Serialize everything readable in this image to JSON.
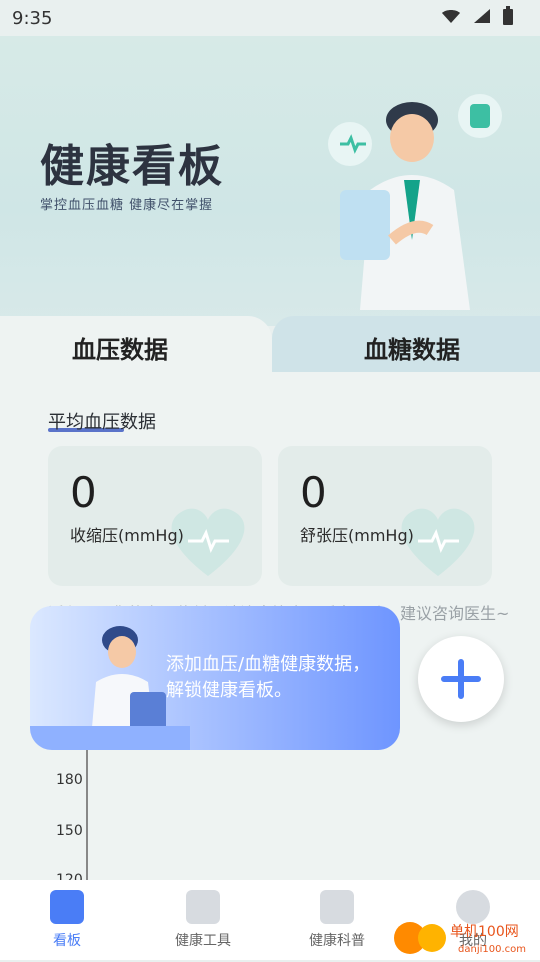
{
  "status": {
    "time": "9:35"
  },
  "hero": {
    "title": "健康看板",
    "subtitle": "掌控血压血糖 健康尽在掌握"
  },
  "tabs": [
    {
      "label": "血压数据"
    },
    {
      "label": "血糖数据"
    }
  ],
  "section": {
    "title": "平均血压数据"
  },
  "stats": [
    {
      "value": "0",
      "label": "收缩压(mmHg)"
    },
    {
      "value": "0",
      "label": "舒张压(mmHg)"
    }
  ],
  "hint": "近七天，您的血压偏低，请注意饮食，适当运动，建议咨询医生~",
  "popup": {
    "text": "添加血压/血糖健康数据，解锁健康看板。"
  },
  "chart": {
    "ticks": [
      "180",
      "150",
      "120"
    ]
  },
  "nav": [
    {
      "label": "看板",
      "icon": "dashboard-icon",
      "active": true
    },
    {
      "label": "健康工具",
      "icon": "toolbox-icon",
      "active": false
    },
    {
      "label": "健康科普",
      "icon": "document-icon",
      "active": false
    },
    {
      "label": "我的",
      "icon": "profile-icon",
      "active": false
    }
  ],
  "watermark": {
    "text": "单机100网",
    "url": "danji100.com"
  },
  "colors": {
    "primary": "#4a7df6",
    "accent": "#3dbfa3"
  }
}
